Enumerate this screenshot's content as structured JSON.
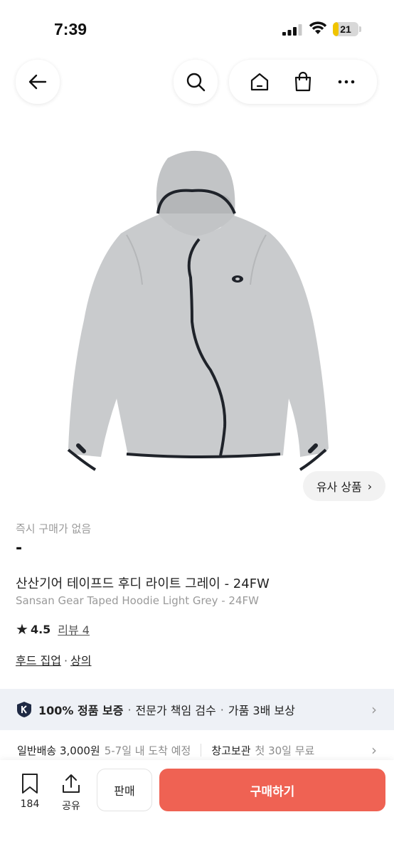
{
  "status_bar": {
    "time": "7:39",
    "battery_level": "21",
    "battery_fraction": 0.21
  },
  "nav": {
    "back_icon": "arrow-left-icon",
    "search_icon": "search-icon",
    "home_icon": "home-icon",
    "bag_icon": "shopping-bag-icon",
    "more_icon": "more-horizontal-icon"
  },
  "product": {
    "image_icon": "grey-hoodie-jacket",
    "similar_button": "유사 상품",
    "instant_purchase_label": "즉시 구매가 없음",
    "price": "-",
    "title_ko": "산산기어 테이프드 후디 라이트 그레이 - 24FW",
    "title_en": "Sansan Gear Taped Hoodie Light Grey - 24FW",
    "rating": "4.5",
    "reviews_label": "리뷰 4",
    "category_1": "후드 집업",
    "category_separator": "·",
    "category_2": "상의"
  },
  "guarantee": {
    "item_1": "100% 정품 보증",
    "item_2": "전문가 책임 검수",
    "item_3": "가품 3배 보상",
    "separator": "·"
  },
  "delivery": {
    "standard_label": "일반배송 3,000원",
    "standard_eta": "5-7일 내 도착 예정",
    "storage_label": "창고보관",
    "storage_note": "첫 30일 무료"
  },
  "bottom_bar": {
    "bookmark_count": "184",
    "share_label": "공유",
    "sell_label": "판매",
    "buy_label": "구매하기"
  },
  "colors": {
    "buy_button": "#ef6253",
    "guarantee_bg": "#eef1f6",
    "battery": "#f0c400"
  }
}
